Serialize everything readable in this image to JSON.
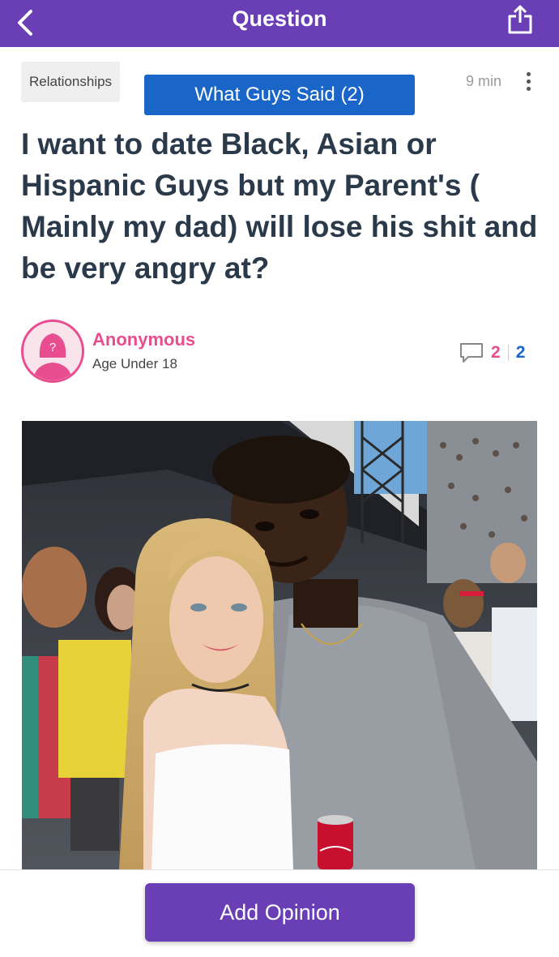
{
  "header": {
    "title": "Question",
    "back_icon": "chevron-left-icon",
    "share_icon": "share-icon",
    "background": "#6a3fb5"
  },
  "question": {
    "category": "Relationships",
    "guys_said_label": "What Guys Said (2)",
    "time": "9 min",
    "more_icon": "vertical-dots-icon",
    "title": "I want to date Black, Asian or Hispanic Guys but my Parent's ( Mainly my dad) will lose his shit and be very angry at?"
  },
  "author": {
    "name": "Anonymous",
    "age": "Age Under 18",
    "avatar_icon": "anonymous-female-avatar-icon",
    "accent_color": "#e84d8f"
  },
  "opinions": {
    "icon": "comment-icon",
    "girls_count": "2",
    "guys_count": "2"
  },
  "photo": {
    "description_icon": "post-photo"
  },
  "footer": {
    "add_opinion_label": "Add Opinion"
  },
  "colors": {
    "primary": "#6a3fb5",
    "guys_blue": "#1a66c8",
    "girls_pink": "#e84d8f",
    "title_text": "#2b3a4a"
  }
}
